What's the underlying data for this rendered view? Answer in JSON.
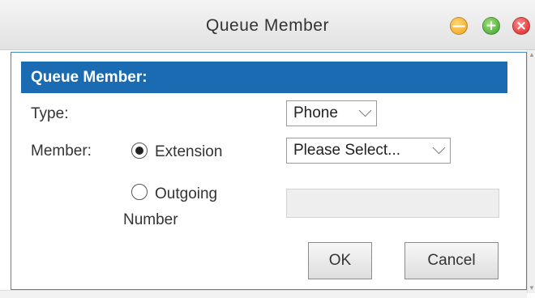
{
  "window": {
    "title": "Queue Member",
    "controls": {
      "minimize_icon": "—",
      "maximize_icon": "+",
      "close_icon": "×"
    }
  },
  "form": {
    "section_title": "Queue Member:",
    "type_label": "Type:",
    "type_value": "Phone",
    "member_label": "Member:",
    "extension_label": "Extension",
    "extension_checked": true,
    "extension_select_value": "Please Select...",
    "outgoing_label_line1": "Outgoing",
    "outgoing_label_line2": "Number",
    "outgoing_checked": false,
    "outgoing_value": ""
  },
  "buttons": {
    "ok": "OK",
    "cancel": "Cancel"
  },
  "colors": {
    "header_bg": "#1b6bb3",
    "dialog_border": "#3b86c4",
    "minimize": "#f1a01a",
    "maximize": "#3ba12a",
    "close": "#d81f1f"
  }
}
